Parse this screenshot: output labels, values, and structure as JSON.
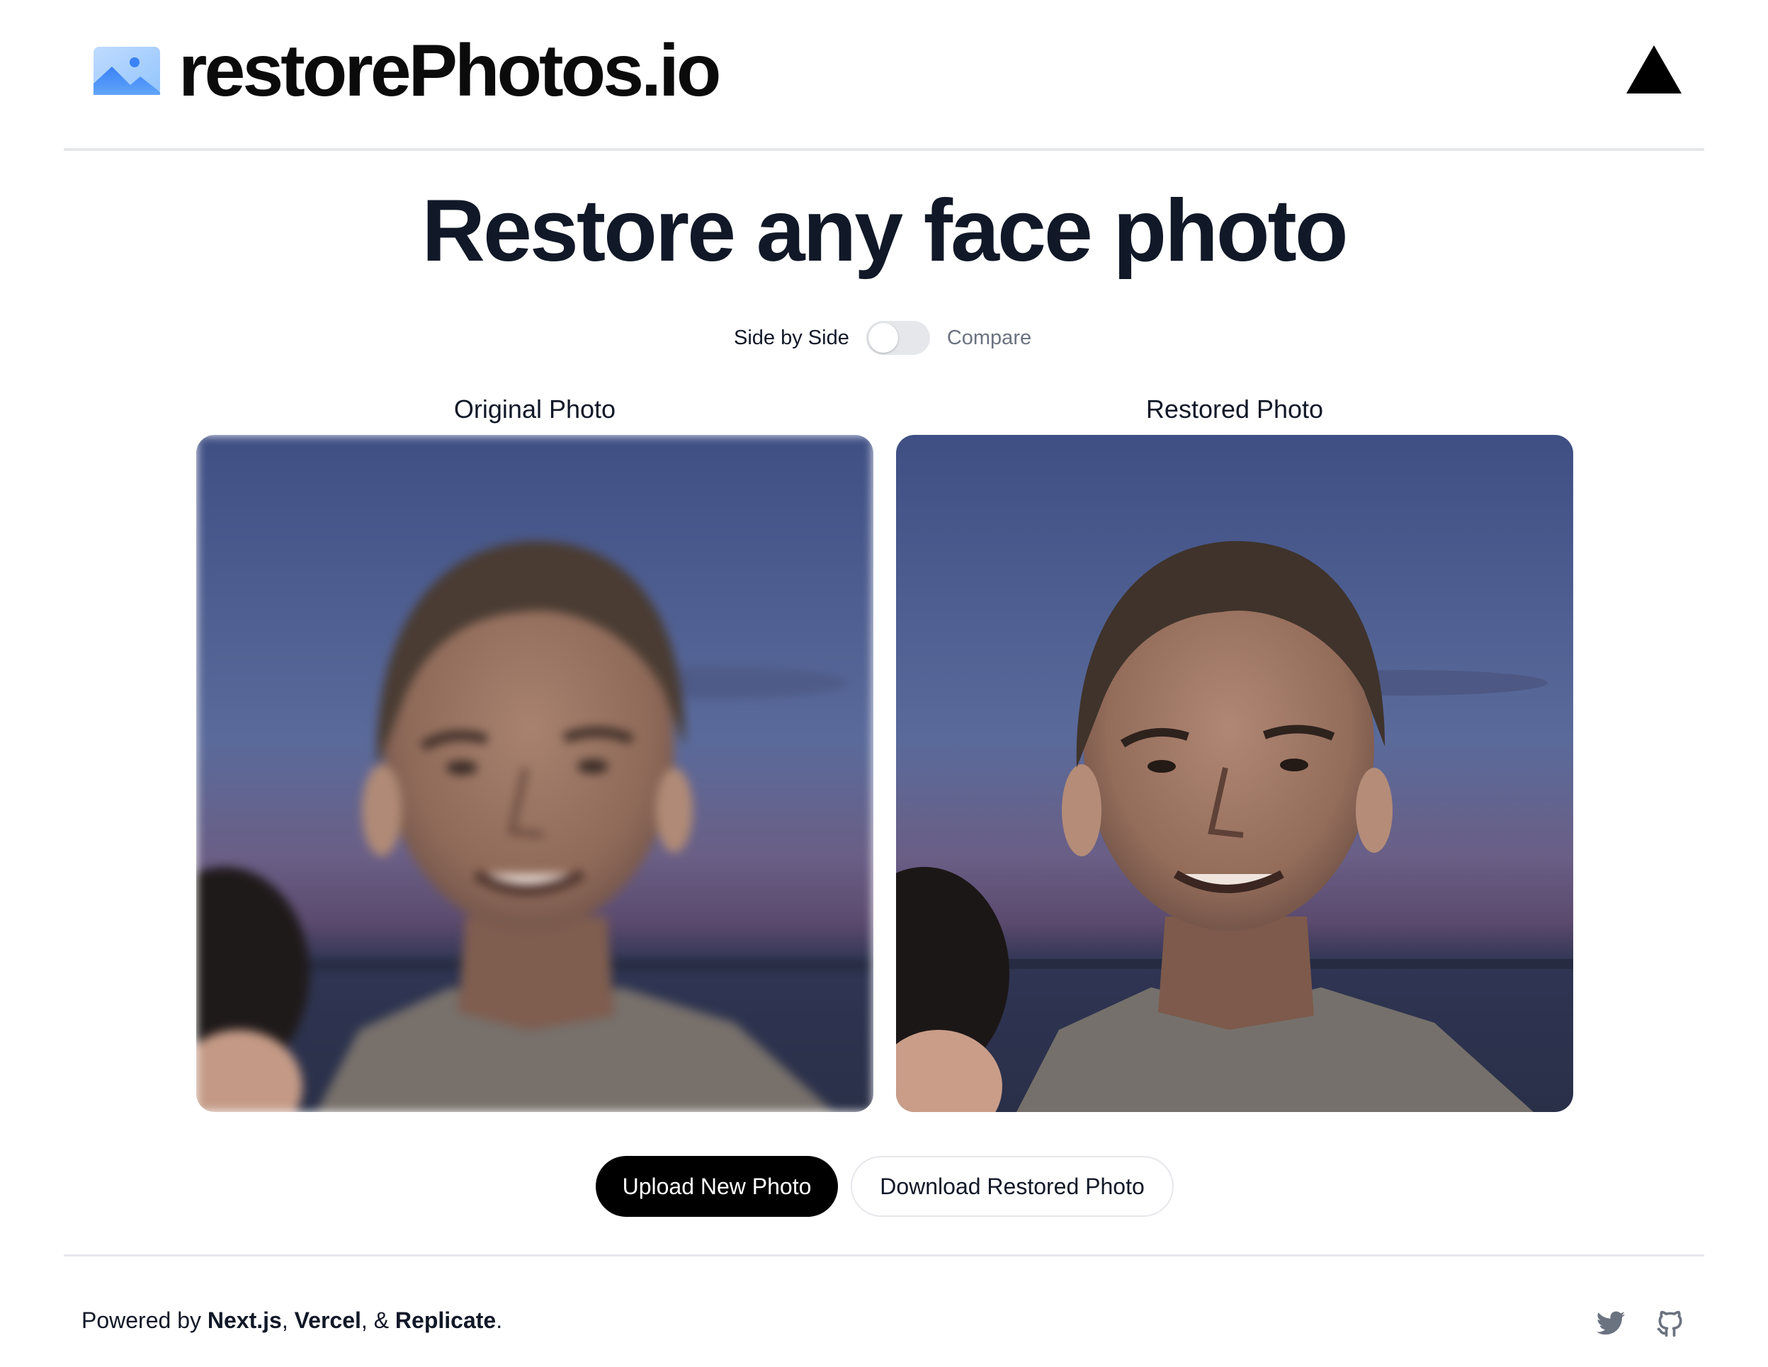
{
  "header": {
    "brand_name": "restorePhotos.io",
    "brand_icon": "photo-icon",
    "right_logo": "vercel-triangle-icon"
  },
  "main": {
    "title": "Restore any face photo",
    "toggle": {
      "left_label": "Side by Side",
      "right_label": "Compare",
      "state": "off"
    },
    "original": {
      "label": "Original Photo"
    },
    "restored": {
      "label": "Restored Photo"
    },
    "buttons": {
      "upload": "Upload New Photo",
      "download": "Download Restored Photo"
    }
  },
  "footer": {
    "powered_prefix": "Powered by ",
    "nextjs": "Next.js",
    "sep1": ", ",
    "vercel": "Vercel",
    "sep2": ", & ",
    "replicate": "Replicate",
    "suffix": ".",
    "icons": [
      "twitter-icon",
      "github-icon"
    ]
  },
  "colors": {
    "primary_button": "#000000",
    "title": "#111827",
    "muted": "#6b7280",
    "divider": "#e5e7eb"
  }
}
